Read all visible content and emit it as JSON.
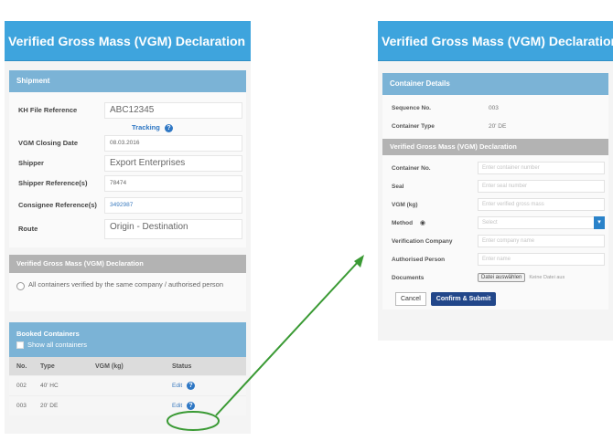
{
  "left": {
    "title": "Verified Gross Mass (VGM) Declaration",
    "shipment_header": "Shipment",
    "fields": [
      {
        "label": "KH File Reference",
        "value": "ABC12345"
      },
      {
        "label": "VGM Closing Date",
        "value": "08.03.2016"
      },
      {
        "label": "Shipper",
        "value": "Export Enterprises"
      },
      {
        "label": "Shipper Reference(s)",
        "value": "78474"
      },
      {
        "label": "Consignee Reference(s)",
        "value": "3492987"
      },
      {
        "label": "Route",
        "value": "Origin - Destination"
      }
    ],
    "tracking_label": "Tracking",
    "vgm_section_header": "Verified Gross Mass (VGM) Declaration",
    "radio_label": "All containers verified by the same company / authorised person",
    "booked_header": "Booked Containers",
    "show_all_label": "Show all containers",
    "table_headers": [
      "No.",
      "Type",
      "VGM (kg)",
      "Status"
    ],
    "rows": [
      {
        "no": "002",
        "type": "40' HC",
        "vgm": "",
        "status": "Edit"
      },
      {
        "no": "003",
        "type": "20' DE",
        "vgm": "",
        "status": "Edit"
      }
    ]
  },
  "right": {
    "title": "Verified Gross Mass (VGM) Declaration",
    "container_header": "Container Details",
    "sequence_label": "Sequence No.",
    "sequence_value": "003",
    "type_label": "Container Type",
    "type_value": "20' DE",
    "vgm_decl_header": "Verified Gross Mass (VGM) Declaration",
    "container_no_label": "Container No.",
    "container_no_placeholder": "Enter container number",
    "seal_label": "Seal",
    "seal_placeholder": "Enter seal number",
    "vgm_label": "VGM (kg)",
    "vgm_placeholder": "Enter verified gross mass",
    "method_label": "Method",
    "method_value": "Select",
    "company_label": "Verification Company",
    "company_placeholder": "Enter company name",
    "person_label": "Authorised Person",
    "person_placeholder": "Enter name",
    "documents_label": "Documents",
    "documents_button": "Datei auswählen",
    "documents_note": "Keine Datei aus",
    "cancel_label": "Cancel",
    "submit_label": "Confirm & Submit"
  },
  "colors": {
    "title_bar": "#3ea4dd",
    "section_header": "#7bb3d6",
    "grey_header": "#b3b3b3",
    "submit_button": "#22478a",
    "annotation": "#3a9a34"
  },
  "icons": {
    "info": "info-circle-icon",
    "help": "eye-help-icon",
    "select_arrow": "chevron-down-icon",
    "arrow": "green-arrow"
  }
}
